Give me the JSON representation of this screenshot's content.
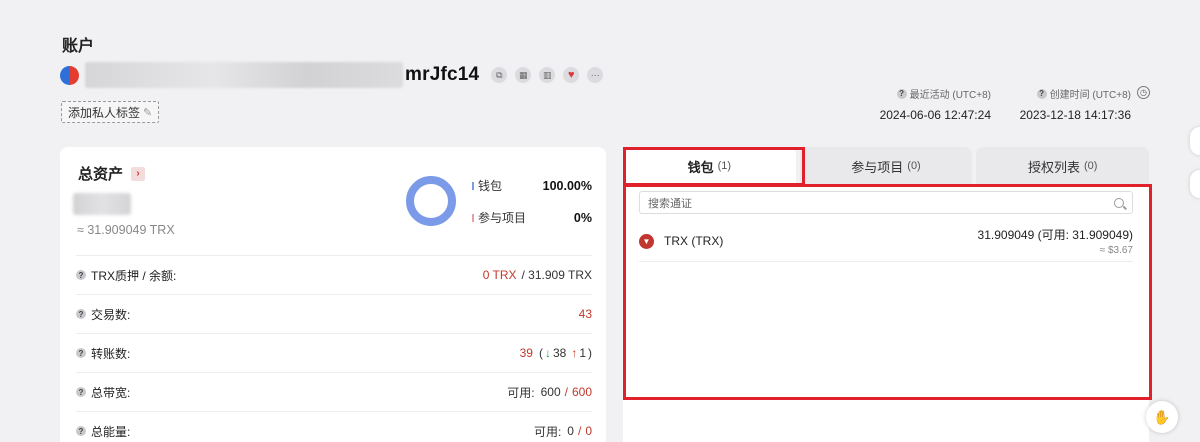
{
  "page": {
    "title": "账户"
  },
  "account": {
    "address_tail": "mrJfc14",
    "actions": [
      {
        "icon": "copy-icon"
      },
      {
        "icon": "qrcode-icon"
      },
      {
        "icon": "chart-icon"
      },
      {
        "icon": "heart-icon"
      },
      {
        "icon": "more-icon"
      }
    ],
    "tag_button": "添加私人标签"
  },
  "meta": {
    "last_active_label": "最近活动 (UTC+8)",
    "last_active_value": "2024-06-06 12:47:24",
    "created_label": "创建时间 (UTC+8)",
    "created_value": "2023-12-18 14:17:36"
  },
  "assets": {
    "title": "总资产",
    "approx": "≈ 31.909049 TRX",
    "legend": [
      {
        "name": "钱包",
        "pct": "100.00%",
        "color": "#7b9be8"
      },
      {
        "name": "参与项目",
        "pct": "0%",
        "color": "#e8a0a0"
      }
    ],
    "stats": {
      "stake_label": "TRX质押 / 余额:",
      "stake_value": "0 TRX",
      "balance_value": "/ 31.909 TRX",
      "tx_label": "交易数:",
      "tx_value": "43",
      "transfer_label": "转账数:",
      "transfer_total": "39",
      "transfer_open": "(",
      "transfer_in": "38",
      "transfer_out": "1",
      "transfer_close": ")",
      "bandwidth_label": "总带宽:",
      "bandwidth_avail_label": "可用:",
      "bandwidth_avail": "600",
      "bandwidth_sep": "/",
      "bandwidth_total": "600",
      "energy_label": "总能量:",
      "energy_avail_label": "可用:",
      "energy_avail": "0",
      "energy_sep": "/",
      "energy_total": "0"
    }
  },
  "tabs": [
    {
      "label": "钱包",
      "count": "(1)",
      "active": true
    },
    {
      "label": "参与项目",
      "count": "(0)",
      "active": false
    },
    {
      "label": "授权列表",
      "count": "(0)",
      "active": false
    }
  ],
  "wallet": {
    "search_placeholder": "搜索通证",
    "tokens": [
      {
        "name": "TRX (TRX)",
        "amount": "31.909049 (可用: 31.909049)",
        "usd": "≈ $3.67"
      }
    ]
  }
}
